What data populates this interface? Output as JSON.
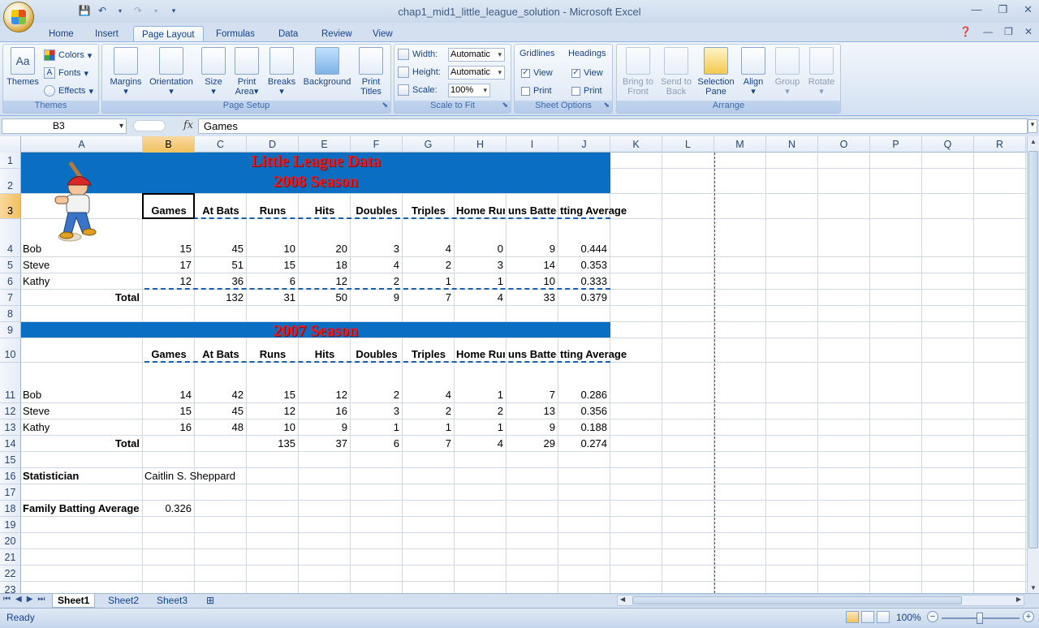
{
  "window": {
    "title": "chap1_mid1_little_league_solution - Microsoft Excel"
  },
  "tabs": [
    "Home",
    "Insert",
    "Page Layout",
    "Formulas",
    "Data",
    "Review",
    "View"
  ],
  "active_tab": "Page Layout",
  "ribbon": {
    "themes": {
      "label": "Themes",
      "themes_btn": "Themes",
      "colors": "Colors",
      "fonts": "Fonts",
      "effects": "Effects"
    },
    "page_setup": {
      "label": "Page Setup",
      "margins": "Margins",
      "orientation": "Orientation",
      "size": "Size",
      "print_area": "Print Area",
      "breaks": "Breaks",
      "background": "Background",
      "print_titles": "Print Titles"
    },
    "scale_to_fit": {
      "label": "Scale to Fit",
      "width_label": "Width:",
      "width_value": "Automatic",
      "height_label": "Height:",
      "height_value": "Automatic",
      "scale_label": "Scale:",
      "scale_value": "100%"
    },
    "sheet_options": {
      "label": "Sheet Options",
      "gridlines": "Gridlines",
      "headings": "Headings",
      "view": "View",
      "print": "Print"
    },
    "arrange": {
      "label": "Arrange",
      "bring_to_front": "Bring to Front",
      "send_to_back": "Send to Back",
      "selection_pane": "Selection Pane",
      "align": "Align",
      "group": "Group",
      "rotate": "Rotate"
    }
  },
  "formula_bar": {
    "name_box": "B3",
    "fx": "fx",
    "content": "Games"
  },
  "columns": [
    "A",
    "B",
    "C",
    "D",
    "E",
    "F",
    "G",
    "H",
    "I",
    "J",
    "K",
    "L",
    "M",
    "N",
    "O",
    "P",
    "Q",
    "R"
  ],
  "rows": [
    "1",
    "2",
    "3",
    "4",
    "5",
    "6",
    "7",
    "8",
    "9",
    "10",
    "11",
    "12",
    "13",
    "14",
    "15",
    "16",
    "17",
    "18",
    "19",
    "20",
    "21",
    "22",
    "23"
  ],
  "sheet": {
    "title1": "Little League Data",
    "title2": "2008 Season",
    "title3": "2007 Season",
    "headers": [
      "Games",
      "At Bats",
      "Runs",
      "Hits",
      "Doubles",
      "Triples",
      "Home Runs",
      "Runs Batted In",
      "Batting Average"
    ],
    "headers_visible": [
      "Games",
      "At Bats",
      "Runs",
      "Hits",
      "Doubles",
      "Triples",
      "Home Run",
      "uns Batted",
      "tting Average"
    ],
    "season2008": [
      {
        "name": "Bob",
        "vals": [
          "15",
          "45",
          "10",
          "20",
          "3",
          "4",
          "0",
          "9",
          "0.444"
        ]
      },
      {
        "name": "Steve",
        "vals": [
          "17",
          "51",
          "15",
          "18",
          "4",
          "2",
          "3",
          "14",
          "0.353"
        ]
      },
      {
        "name": "Kathy",
        "vals": [
          "12",
          "36",
          "6",
          "12",
          "2",
          "1",
          "1",
          "10",
          "0.333"
        ]
      }
    ],
    "total2008": {
      "label": "Total",
      "vals": [
        "",
        "132",
        "31",
        "50",
        "9",
        "7",
        "4",
        "33",
        "0.379"
      ]
    },
    "season2007": [
      {
        "name": "Bob",
        "vals": [
          "14",
          "42",
          "15",
          "12",
          "2",
          "4",
          "1",
          "7",
          "0.286"
        ]
      },
      {
        "name": "Steve",
        "vals": [
          "15",
          "45",
          "12",
          "16",
          "3",
          "2",
          "2",
          "13",
          "0.356"
        ]
      },
      {
        "name": "Kathy",
        "vals": [
          "16",
          "48",
          "10",
          "9",
          "1",
          "1",
          "1",
          "9",
          "0.188"
        ]
      }
    ],
    "total2007": {
      "label": "Total",
      "vals": [
        "",
        "",
        "135",
        "37",
        "6",
        "7",
        "4",
        "29",
        "0.274"
      ]
    },
    "statistician_label": "Statistician",
    "statistician_value": "Caitlin S. Sheppard",
    "family_label": "Family Batting Average",
    "family_value": "0.326"
  },
  "sheet_tabs": [
    "Sheet1",
    "Sheet2",
    "Sheet3"
  ],
  "status": {
    "text": "Ready",
    "zoom": "100%"
  }
}
